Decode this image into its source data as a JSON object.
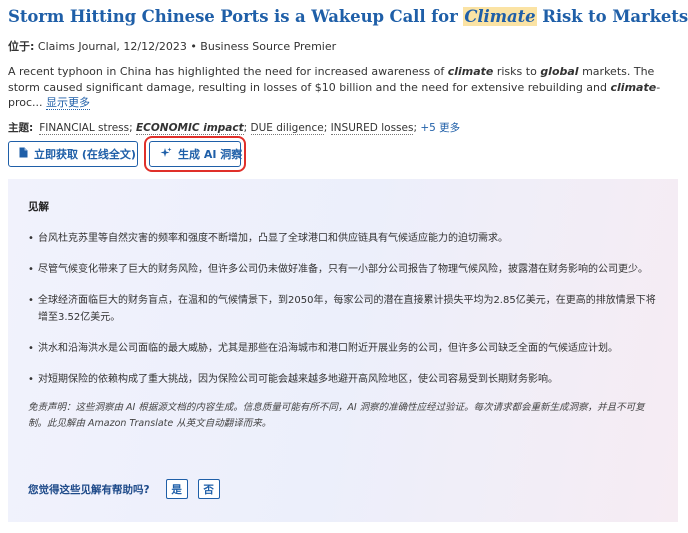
{
  "article": {
    "title_pre": "Storm Hitting Chinese Ports is a Wakeup Call for ",
    "title_highlight": "Climate",
    "title_post": " Risk to Markets.",
    "source_label": "位于:",
    "source_text": "Claims Journal, 12/12/2023 • Business Source Premier",
    "abstract_1": "A recent typhoon in China has highlighted the need for increased awareness of ",
    "abstract_kw1": "climate",
    "abstract_2": " risks to ",
    "abstract_kw2": "global",
    "abstract_3": " markets. The storm caused significant damage, resulting in losses of $10 billion and the need for extensive rebuilding and ",
    "abstract_kw3": "climate",
    "abstract_4": "-proc...",
    "show_more": "显示更多",
    "subjects_label": "主题:",
    "subject_1": "FINANCIAL stress",
    "subject_2": "ECONOMIC impact",
    "subject_3": "DUE diligence",
    "subject_4": "INSURED losses",
    "sep": "; ",
    "subjects_more": "+5 更多"
  },
  "buttons": {
    "full_text": "立即获取 (在线全文)",
    "ai_insight": "生成 AI 洞察"
  },
  "insights": {
    "heading": "见解",
    "items": [
      "台风杜克苏里等自然灾害的频率和强度不断增加，凸显了全球港口和供应链具有气候适应能力的迫切需求。",
      "尽管气候变化带来了巨大的财务风险，但许多公司仍未做好准备，只有一小部分公司报告了物理气候风险，披露潜在财务影响的公司更少。",
      "全球经济面临巨大的财务盲点，在温和的气候情景下，到2050年，每家公司的潜在直接累计损失平均为2.85亿美元，在更高的排放情景下将增至3.52亿美元。",
      "洪水和沿海洪水是公司面临的最大威胁，尤其是那些在沿海城市和港口附近开展业务的公司，但许多公司缺乏全面的气候适应计划。",
      "对短期保险的依赖构成了重大挑战，因为保险公司可能会越来越多地避开高风险地区，使公司容易受到长期财务影响。"
    ],
    "disclaimer": "免责声明：这些洞察由 AI 根据源文档的内容生成。信息质量可能有所不同，AI 洞察的准确性应经过验证。每次请求都会重新生成洞察，并且不可复制。此见解由 Amazon Translate 从英文自动翻译而来。",
    "feedback_question": "您觉得这些见解有帮助吗?",
    "yes": "是",
    "no": "否"
  },
  "colors": {
    "link": "#1f5fa8",
    "highlight": "#fbe3a4",
    "focus_outline": "#e0302a"
  },
  "icons": {
    "full_text": "document-icon",
    "ai": "sparkle-icon"
  }
}
